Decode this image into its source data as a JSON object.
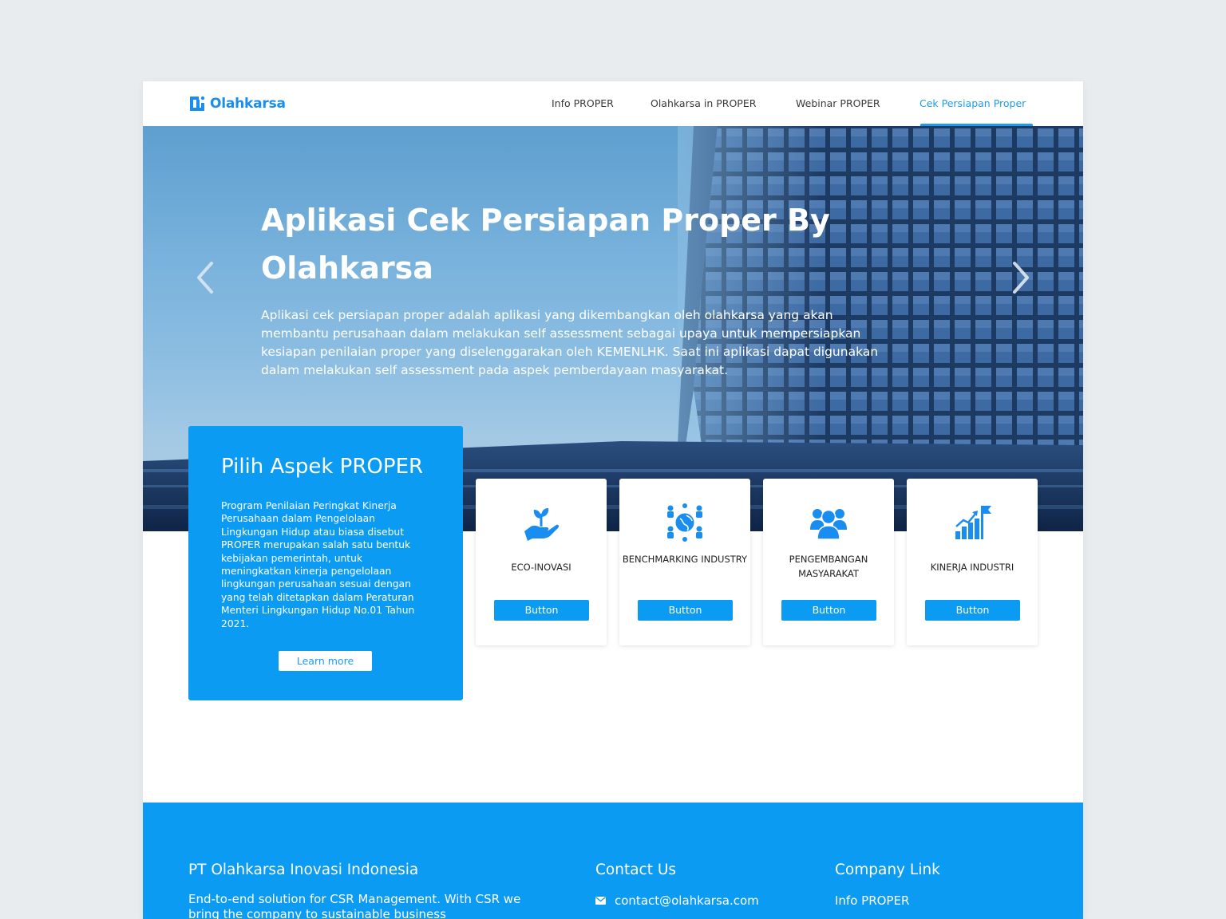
{
  "nav": {
    "brand": "Olahkarsa",
    "links": [
      {
        "label": "Info PROPER"
      },
      {
        "label": "Olahkarsa in PROPER"
      },
      {
        "label": "Webinar PROPER"
      },
      {
        "label": "Cek Persiapan Proper",
        "active": true
      }
    ]
  },
  "hero": {
    "title": "Aplikasi Cek Persiapan Proper By Olahkarsa",
    "description": "Aplikasi cek persiapan proper adalah aplikasi yang dikembangkan oleh olahkarsa yang akan membantu perusahaan dalam melakukan self assessment sebagai upaya untuk mempersiapkan kesiapan penilaian proper yang diselenggarakan oleh KEMENLHK. Saat ini aplikasi dapat digunakan dalam melakukan self assessment pada aspek pemberdayaan masyarakat."
  },
  "pilih": {
    "title": "Pilih Aspek PROPER",
    "text": "Program Penilaian Peringkat Kinerja Perusahaan dalam Pengelolaan Lingkungan Hidup atau biasa disebut PROPER merupakan salah satu bentuk kebijakan pemerintah, untuk meningkatkan kinerja pengelolaan lingkungan perusahaan sesuai dengan yang telah ditetapkan dalam Peraturan Menteri Lingkungan Hidup No.01 Tahun 2021.",
    "button": "Learn more"
  },
  "aspects": [
    {
      "label": "ECO-INOVASI",
      "icon": "hand-plant-icon",
      "button": "Button"
    },
    {
      "label": "BENCHMARKING INDUSTRY",
      "icon": "global-network-icon",
      "button": "Button"
    },
    {
      "label": "PENGEMBANGAN MASYARAKAT",
      "icon": "people-group-icon",
      "button": "Button"
    },
    {
      "label": "KINERJA INDUSTRI",
      "icon": "growth-chart-icon",
      "button": "Button"
    }
  ],
  "footer": {
    "company": "PT Olahkarsa Inovasi Indonesia",
    "tagline": "End-to-end solution for CSR Management. With CSR we bring the company to sustainable business",
    "contact_heading": "Contact Us",
    "email": "contact@olahkarsa.com",
    "links_heading": "Company Link",
    "links": [
      "Info PROPER"
    ]
  },
  "colors": {
    "brand_blue": "#0c9bf3",
    "nav_active": "#1d9bf0",
    "page_bg": "#e8ecef"
  }
}
